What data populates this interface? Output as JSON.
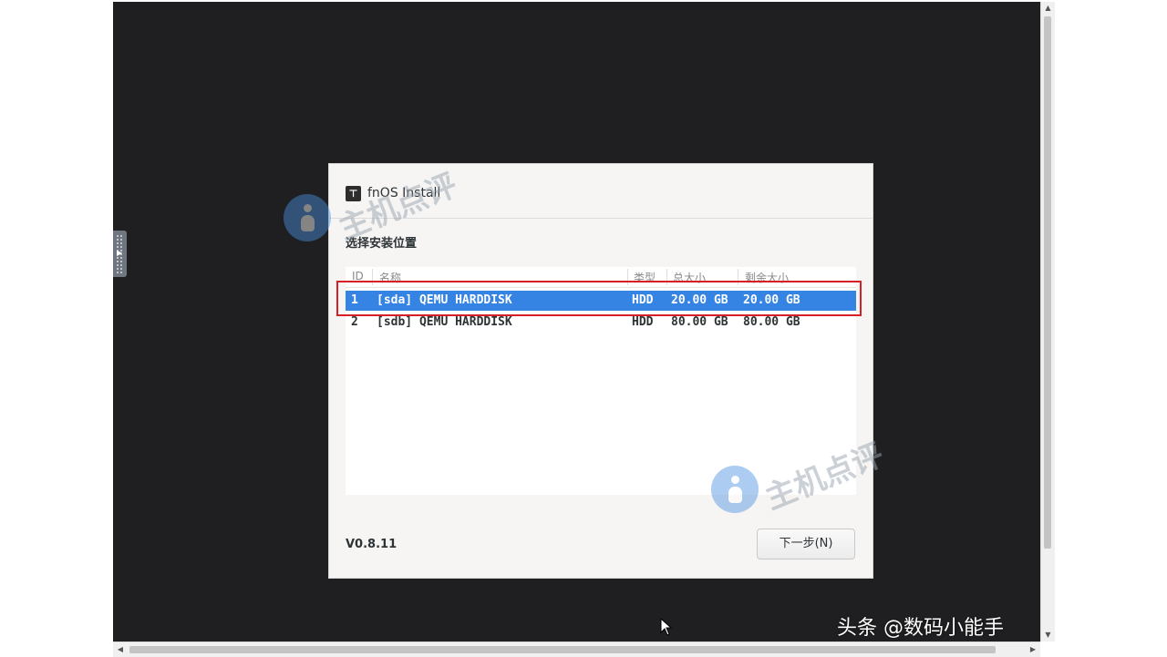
{
  "dialog": {
    "title": "fnOS Install",
    "logo_glyph": "⊤",
    "section_title": "选择安装位置",
    "version": "V0.8.11",
    "next_button": "下一步(N)"
  },
  "table": {
    "columns": [
      "ID",
      "名称",
      "类型",
      "总大小",
      "剩余大小"
    ],
    "rows": [
      {
        "id": "1",
        "name": "[sda] QEMU HARDDISK",
        "type": "HDD",
        "total": "20.00 GB",
        "free": "20.00 GB",
        "selected": true
      },
      {
        "id": "2",
        "name": "[sdb] QEMU HARDDISK",
        "type": "HDD",
        "total": "80.00 GB",
        "free": "80.00 GB",
        "selected": false
      }
    ]
  },
  "watermark": {
    "text_top": "主机点评",
    "text_bottom": "主机点评"
  },
  "corner_brand": "头条 @数码小能手",
  "colors": {
    "selection": "#3584e4",
    "highlight_outline": "#d61f26",
    "vm_background": "#1f1f21",
    "dialog_background": "#f6f5f4"
  },
  "icons": [
    "fnos-logo-icon",
    "person-watermark-icon",
    "mouse-cursor-icon",
    "scroll-arrow-icon"
  ]
}
